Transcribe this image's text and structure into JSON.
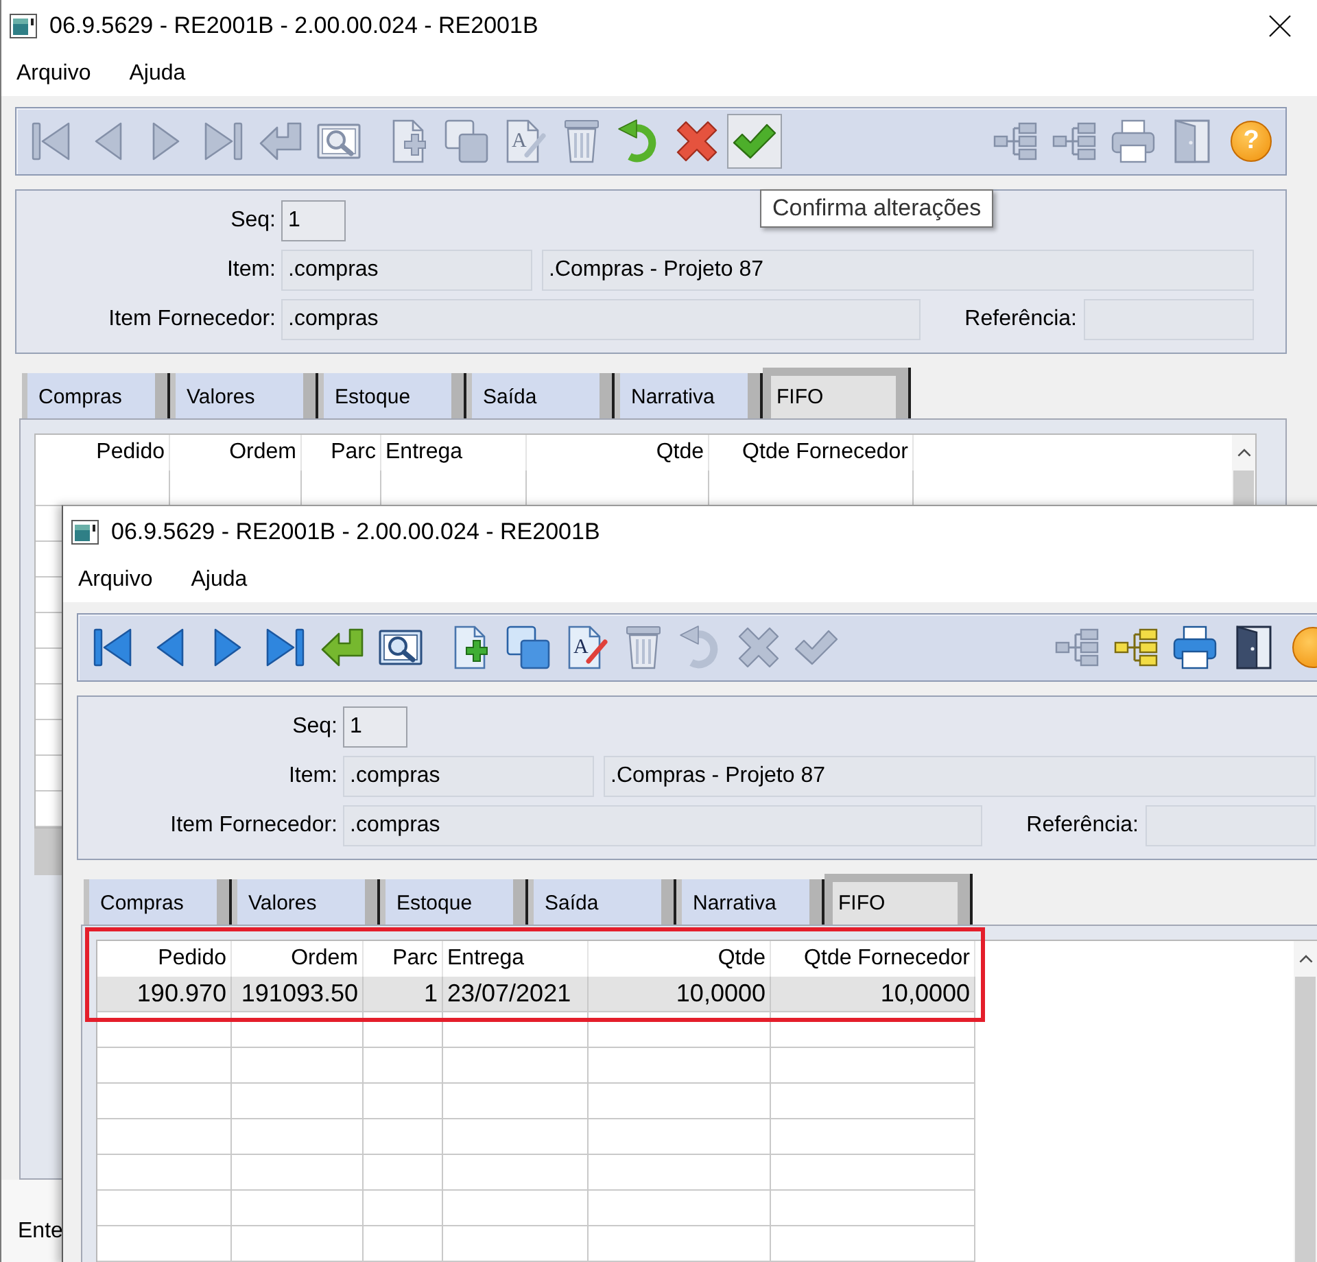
{
  "windows": [
    {
      "title": "06.9.5629 - RE2001B - 2.00.00.024 - RE2001B",
      "title_buttons": [
        {
          "kind": "close"
        }
      ],
      "menu": [
        {
          "label": "Arquivo"
        },
        {
          "label": "Ajuda"
        }
      ],
      "toolbar": {
        "left_groups": [
          [
            {
              "kind": "first",
              "disabled": true,
              "hovered": false
            },
            {
              "kind": "prev",
              "disabled": true,
              "hovered": false
            },
            {
              "kind": "next",
              "disabled": true,
              "hovered": false
            },
            {
              "kind": "last",
              "disabled": true,
              "hovered": false
            },
            {
              "kind": "return",
              "disabled": true,
              "hovered": false
            },
            {
              "kind": "zoom",
              "disabled": true,
              "hovered": false
            }
          ],
          [
            {
              "kind": "new",
              "disabled": true,
              "hovered": false
            },
            {
              "kind": "copy",
              "disabled": true,
              "hovered": false
            },
            {
              "kind": "edit",
              "glyph": "A",
              "disabled": true,
              "hovered": false
            },
            {
              "kind": "delete",
              "disabled": true,
              "hovered": false
            },
            {
              "kind": "undo",
              "disabled": false,
              "hovered": false
            },
            {
              "kind": "cancel",
              "disabled": false,
              "hovered": false
            },
            {
              "kind": "confirm",
              "disabled": false,
              "hovered": true
            }
          ]
        ],
        "right_group": [
          {
            "kind": "tree",
            "disabled": true,
            "hovered": false
          },
          {
            "kind": "tree",
            "disabled": true,
            "hovered": false
          },
          {
            "kind": "print",
            "disabled": true,
            "hovered": false
          },
          {
            "kind": "exit",
            "disabled": true,
            "hovered": false
          },
          {
            "kind": "help",
            "glyph": "?",
            "disabled": false,
            "hovered": false
          }
        ]
      },
      "tooltip": "Confirma alterações",
      "form": {
        "rows": [
          {
            "label": "Seq:",
            "fields": [
              {
                "kind": "short",
                "value": "1",
                "disabled": false
              }
            ]
          },
          {
            "label": "Item:",
            "fields": [
              {
                "kind": "medium",
                "value": ".compras",
                "disabled": true
              },
              {
                "kind": "fill",
                "value": ".Compras - Projeto 87",
                "disabled": true
              }
            ]
          },
          {
            "label": "Item Fornecedor:",
            "fields": [
              {
                "kind": "wide",
                "value": ".compras",
                "disabled": true
              },
              {
                "kind": "label",
                "label": "Referência:"
              },
              {
                "kind": "small",
                "disabled": true
              }
            ]
          }
        ]
      },
      "tabs": [
        {
          "label": "Compras",
          "selected": false
        },
        {
          "label": "Valores",
          "selected": false
        },
        {
          "label": "Estoque",
          "selected": false
        },
        {
          "label": "Saída",
          "selected": false
        },
        {
          "label": "Narrativa",
          "selected": false
        },
        {
          "label": "FIFO",
          "selected": true
        }
      ],
      "table": {
        "highlighted": false,
        "horizontal_scrollbar": true,
        "columns": [
          {
            "label": "Pedido",
            "kind": "number"
          },
          {
            "label": "Ordem",
            "kind": "number"
          },
          {
            "label": "Parc",
            "kind": "number"
          },
          {
            "label": "Entrega",
            "kind": "date"
          },
          {
            "label": "Qtde",
            "kind": "number"
          },
          {
            "label": "Qtde Fornecedor",
            "kind": "number"
          }
        ]
      },
      "status_bar": "Ente"
    },
    {
      "title": "06.9.5629 - RE2001B - 2.00.00.024 - RE2001B",
      "menu": [
        {
          "label": "Arquivo"
        },
        {
          "label": "Ajuda"
        }
      ],
      "toolbar": {
        "left_groups": [
          [
            {
              "kind": "first",
              "disabled": false,
              "hovered": false
            },
            {
              "kind": "prev",
              "disabled": false,
              "hovered": false
            },
            {
              "kind": "next",
              "disabled": false,
              "hovered": false
            },
            {
              "kind": "last",
              "disabled": false,
              "hovered": false
            },
            {
              "kind": "return",
              "disabled": false,
              "hovered": false
            },
            {
              "kind": "zoom",
              "disabled": false,
              "hovered": false
            }
          ],
          [
            {
              "kind": "new",
              "disabled": false,
              "hovered": false
            },
            {
              "kind": "copy",
              "disabled": false,
              "hovered": false
            },
            {
              "kind": "edit",
              "glyph": "A",
              "disabled": false,
              "hovered": false
            },
            {
              "kind": "delete",
              "disabled": true,
              "hovered": false
            },
            {
              "kind": "undo",
              "disabled": true,
              "hovered": false
            },
            {
              "kind": "cancel",
              "disabled": true,
              "hovered": false
            },
            {
              "kind": "confirm",
              "disabled": true,
              "hovered": false
            }
          ]
        ],
        "right_group": [
          {
            "kind": "tree",
            "disabled": true,
            "hovered": false
          },
          {
            "kind": "tree",
            "disabled": false,
            "hovered": false
          },
          {
            "kind": "print",
            "disabled": false,
            "hovered": false
          },
          {
            "kind": "exit",
            "disabled": false,
            "hovered": false
          },
          {
            "kind": "help",
            "disabled": false,
            "hovered": false
          }
        ]
      },
      "form": {
        "rows": [
          {
            "label": "Seq:",
            "fields": [
              {
                "kind": "short",
                "value": "1",
                "disabled": false
              }
            ]
          },
          {
            "label": "Item:",
            "fields": [
              {
                "kind": "medium",
                "value": ".compras",
                "disabled": true
              },
              {
                "kind": "fill",
                "value": ".Compras - Projeto 87",
                "disabled": true
              }
            ]
          },
          {
            "label": "Item Fornecedor:",
            "fields": [
              {
                "kind": "wide",
                "value": ".compras",
                "disabled": true
              },
              {
                "kind": "label",
                "label": "Referência:"
              },
              {
                "kind": "small",
                "disabled": true
              }
            ]
          }
        ]
      },
      "tabs": [
        {
          "label": "Compras",
          "selected": false
        },
        {
          "label": "Valores",
          "selected": false
        },
        {
          "label": "Estoque",
          "selected": false
        },
        {
          "label": "Saída",
          "selected": false
        },
        {
          "label": "Narrativa",
          "selected": false
        },
        {
          "label": "FIFO",
          "selected": true
        }
      ],
      "table": {
        "highlighted": true,
        "horizontal_scrollbar": false,
        "columns": [
          {
            "label": "Pedido",
            "kind": "number"
          },
          {
            "label": "Ordem",
            "kind": "number"
          },
          {
            "label": "Parc",
            "kind": "number"
          },
          {
            "label": "Entrega",
            "kind": "date"
          },
          {
            "label": "Qtde",
            "kind": "number"
          },
          {
            "label": "Qtde Fornecedor",
            "kind": "number"
          }
        ],
        "rows": [
          {
            "selected": true,
            "cells": [
              "190.970",
              "191093.50",
              "1",
              "23/07/2021",
              "10,0000",
              "10,0000"
            ]
          }
        ]
      }
    }
  ]
}
